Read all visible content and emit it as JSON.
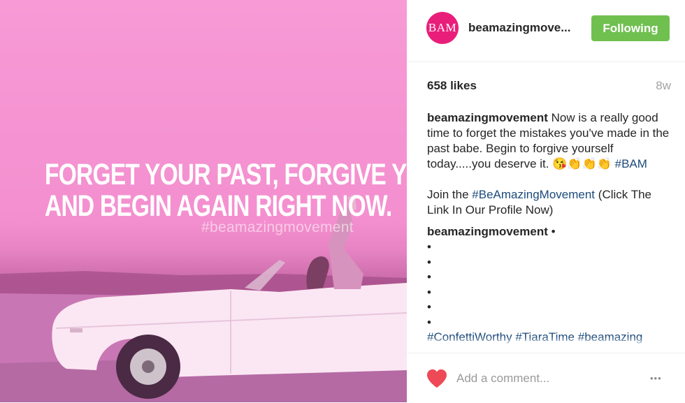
{
  "post": {
    "image": {
      "quote_line1": "Forget your past, forgive yourself,",
      "quote_line2": "and begin again right now.",
      "watermark": "#beamazingmovement",
      "tint_color": "#f79ad6"
    },
    "header": {
      "avatar_text": "BAM",
      "avatar_color": "#e91e7a",
      "username": "beamazingmove...",
      "follow_label": "Following",
      "follow_color": "#70c050"
    },
    "stats": {
      "likes": "658 likes",
      "age": "8w"
    },
    "caption": {
      "username": "beamazingmovement",
      "text": "Now is a really good time to forget the mistakes you've made in the past babe. Begin to forgive yourself today.....you deserve it.",
      "emojis": "😘👏👏👏",
      "hashtag1": "#BAM",
      "join_prefix": "Join the",
      "join_hashtag": "#BeAmazingMovement",
      "join_suffix": "(Click The Link In Our Profile Now)",
      "username2": "beamazingmovement",
      "bullet": "•",
      "hashtags": [
        "#ConfettiWorthy",
        "#TiaraTime",
        "#beamazing"
      ]
    },
    "comment": {
      "placeholder": "Add a comment...",
      "more_icon": "•••",
      "heart_color": "#ed4956"
    }
  }
}
